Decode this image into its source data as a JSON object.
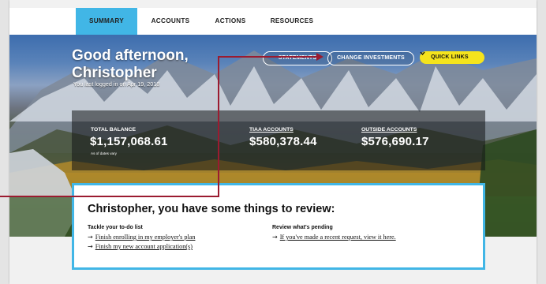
{
  "nav": {
    "tabs": [
      {
        "label": "SUMMARY",
        "active": true
      },
      {
        "label": "ACCOUNTS",
        "active": false
      },
      {
        "label": "ACTIONS",
        "active": false
      },
      {
        "label": "RESOURCES",
        "active": false
      }
    ]
  },
  "hero": {
    "greeting_line1": "Good afternoon,",
    "greeting_line2": "Christopher",
    "last_login": "You last logged in on Apr 19, 2018",
    "buttons": {
      "statements": "STATEMENTS",
      "change_investments": "CHANGE INVESTMENTS",
      "quick_links": "QUICK LINKS",
      "quick_links_icon": "chevron-down-icon"
    }
  },
  "balances": {
    "total": {
      "label": "TOTAL BALANCE",
      "value": "$1,157,068.61",
      "note": "As of dates vary"
    },
    "tiaa": {
      "label": "TIAA ACCOUNTS",
      "value": "$580,378.44"
    },
    "outside": {
      "label": "OUTSIDE ACCOUNTS",
      "value": "$576,690.17"
    }
  },
  "review": {
    "title": "Christopher, you have some things to review:",
    "todo": {
      "heading": "Tackle your to-do list",
      "items": [
        "Finish enrolling in my employer's plan",
        "Finish my new account application(s)"
      ]
    },
    "pending": {
      "heading": "Review what's pending",
      "items": [
        "If you've made a recent request, view it here."
      ]
    }
  },
  "colors": {
    "accent_blue": "#41b6e6",
    "accent_yellow": "#f5e41c",
    "connector_red": "#9b1b30"
  }
}
